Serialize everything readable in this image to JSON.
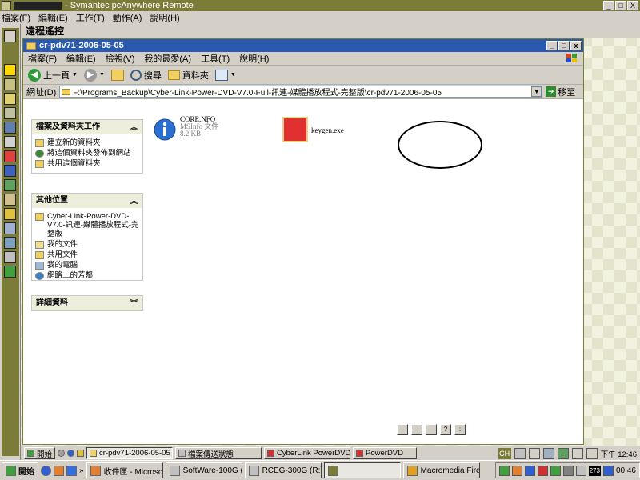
{
  "outer_window": {
    "title": "- Symantec pcAnywhere Remote",
    "menu": [
      "檔案(F)",
      "編輯(E)",
      "工作(T)",
      "動作(A)",
      "說明(H)"
    ],
    "controls": [
      "_",
      "□",
      "X"
    ]
  },
  "remote": {
    "header": "遠程遙控"
  },
  "explorer": {
    "title": "cr-pdv71-2006-05-05",
    "controls": [
      "_",
      "□",
      "x"
    ],
    "menu": [
      "檔案(F)",
      "編輯(E)",
      "檢視(V)",
      "我的最愛(A)",
      "工具(T)",
      "說明(H)"
    ],
    "toolbar": {
      "back": "上一頁",
      "search": "搜尋",
      "folders": "資料夾"
    },
    "address": {
      "label": "網址(D)",
      "path": "F:\\Programs_Backup\\Cyber-Link-Power-DVD-V7.0-Full-訊連-媒體播放程式-完整版\\cr-pdv71-2006-05-05",
      "go": "移至"
    },
    "task_panels": {
      "file_tasks": {
        "title": "檔案及資料夾工作",
        "items": [
          "建立新的資料夾",
          "將這個資料夾發佈到網站",
          "共用這個資料夾"
        ]
      },
      "other_places": {
        "title": "其他位置",
        "items": [
          "Cyber-Link-Power-DVD-V7.0-訊連-媒體播放程式-完整版",
          "我的文件",
          "共用文件",
          "我的電腦",
          "網路上的芳鄰"
        ]
      },
      "details": {
        "title": "詳細資料"
      }
    },
    "files": [
      {
        "name": "CORE.NFO",
        "type": "MSInfo 文件",
        "size": "8.2 KB",
        "icon": "info-icon"
      },
      {
        "name": "keygen.exe",
        "icon": "keygen-app-icon"
      }
    ]
  },
  "remote_taskbar": {
    "start": "開始",
    "buttons": [
      "cr-pdv71-2006-05-05",
      "檔案傳送狀態",
      "CyberLink PowerDVD",
      "PowerDVD"
    ],
    "ime": "CH",
    "clock": "下午 12:46"
  },
  "local_taskbar": {
    "start": "開始",
    "buttons": [
      "收件匣 - Microsoft...",
      "SoftWare-100G (V:)",
      "RCEG-300G (R:)",
      "",
      "Macromedia Firew..."
    ],
    "tray_number": "273",
    "clock": "00:46"
  }
}
